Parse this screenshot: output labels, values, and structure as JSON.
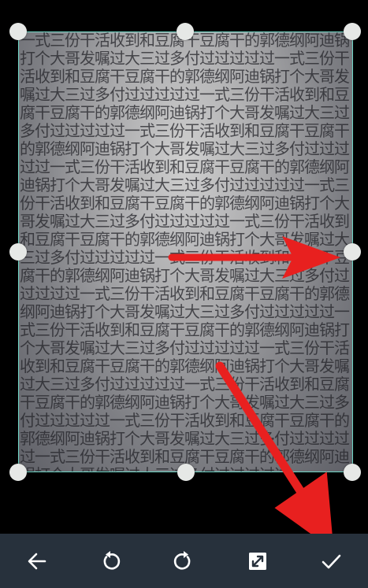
{
  "photo": {
    "text_pattern": "一式三份干活收到和豆腐干豆腐干的郭德纲阿迪锅打个大哥发嘱过大三过多付过过过过过"
  },
  "toolbar": {
    "back_icon": "arrow-left-icon",
    "rotate_left_icon": "rotate-left-icon",
    "rotate_right_icon": "rotate-right-icon",
    "expand_icon": "expand-icon",
    "confirm_icon": "check-icon"
  },
  "colors": {
    "crop_border": "#6fd6c6",
    "toolbar_bg": "#27313c",
    "annotation_arrow": "#e8201f",
    "handle": "#e6e8e6"
  }
}
